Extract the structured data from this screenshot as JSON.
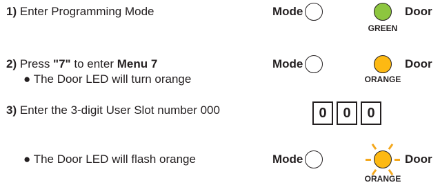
{
  "colors": {
    "green": "#8dc63f",
    "orange": "#fdb913",
    "ray": "#f4a81d",
    "led_off": "#ffffff"
  },
  "labels": {
    "mode": "Mode",
    "door": "Door"
  },
  "steps": [
    {
      "number": "1)",
      "text": "Enter Programming Mode",
      "door_led": "green",
      "caption": "GREEN"
    },
    {
      "number": "2)",
      "text_pre": "Press ",
      "text_key": "\"7\"",
      "text_mid": " to enter ",
      "text_menu": "Menu 7",
      "bullet": "● The Door LED will turn orange",
      "door_led": "orange",
      "caption": "ORANGE"
    },
    {
      "number": "3)",
      "text": "Enter the 3-digit User Slot number 000",
      "digits": [
        "0",
        "0",
        "0"
      ]
    },
    {
      "bullet": "● The Door LED will flash orange",
      "door_led": "orange-flashing",
      "caption": "ORANGE"
    }
  ]
}
